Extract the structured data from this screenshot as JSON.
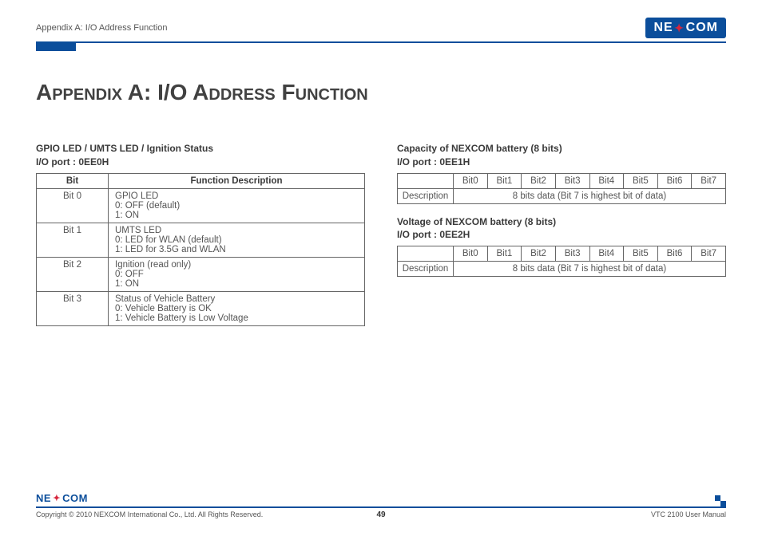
{
  "header": {
    "breadcrumb": "Appendix A: I/O Address Function",
    "brand_left": "NE",
    "brand_right": "COM"
  },
  "title": "Appendix A: I/O Address Function",
  "left": {
    "heading_line1": "GPIO LED / UMTS LED / Ignition Status",
    "heading_line2": "I/O port : 0EE0H",
    "th_bit": "Bit",
    "th_desc": "Function Description",
    "rows": [
      {
        "bit": "Bit 0",
        "l1": "GPIO LED",
        "l2": "0: OFF (default)",
        "l3": "1: ON"
      },
      {
        "bit": "Bit 1",
        "l1": "UMTS LED",
        "l2": "0: LED for WLAN (default)",
        "l3": "1: LED for 3.5G and WLAN"
      },
      {
        "bit": "Bit 2",
        "l1": "Ignition (read only)",
        "l2": "0: OFF",
        "l3": "1: ON"
      },
      {
        "bit": "Bit 3",
        "l1": "Status of Vehicle Battery",
        "l2": "0: Vehicle Battery is OK",
        "l3": "1: Vehicle Battery is Low Voltage"
      }
    ]
  },
  "right": {
    "sec1_line1": "Capacity of NEXCOM battery (8 bits)",
    "sec1_line2": "I/O port : 0EE1H",
    "sec2_line1": "Voltage of NEXCOM battery (8 bits)",
    "sec2_line2": "I/O port : 0EE2H",
    "bits": [
      "Bit0",
      "Bit1",
      "Bit2",
      "Bit3",
      "Bit4",
      "Bit5",
      "Bit6",
      "Bit7"
    ],
    "desc_label": "Description",
    "desc_value": "8 bits data (Bit 7 is highest bit of data)"
  },
  "footer": {
    "copyright": "Copyright © 2010 NEXCOM International Co., Ltd. All Rights Reserved.",
    "page": "49",
    "manual": "VTC 2100 User Manual"
  }
}
